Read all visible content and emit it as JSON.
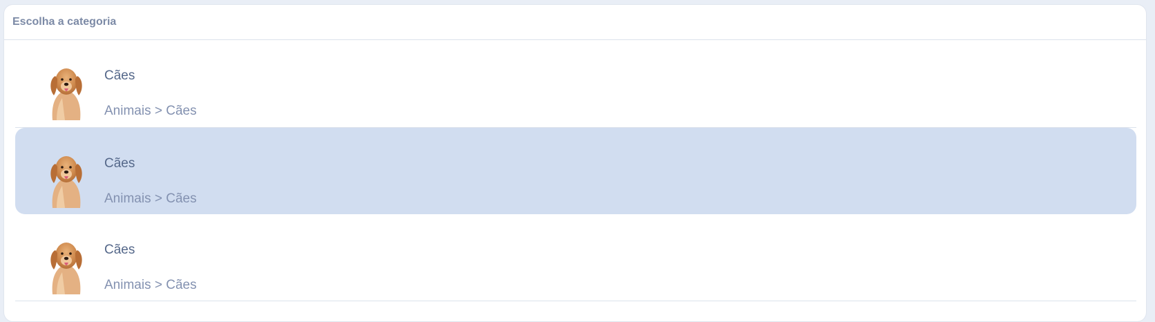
{
  "header": {
    "title": "Escolha a categoria"
  },
  "colors": {
    "selected_background": "#d1ddf0",
    "title_text": "#55688a",
    "path_text": "#8391b0"
  },
  "categories": [
    {
      "title": "Cães",
      "path": "Animais > Cães",
      "icon": "golden-retriever-photo",
      "selected": false
    },
    {
      "title": "Cães",
      "path": "Animais > Cães",
      "icon": "golden-retriever-photo",
      "selected": true
    },
    {
      "title": "Cães",
      "path": "Animais > Cães",
      "icon": "golden-retriever-photo",
      "selected": false
    }
  ]
}
